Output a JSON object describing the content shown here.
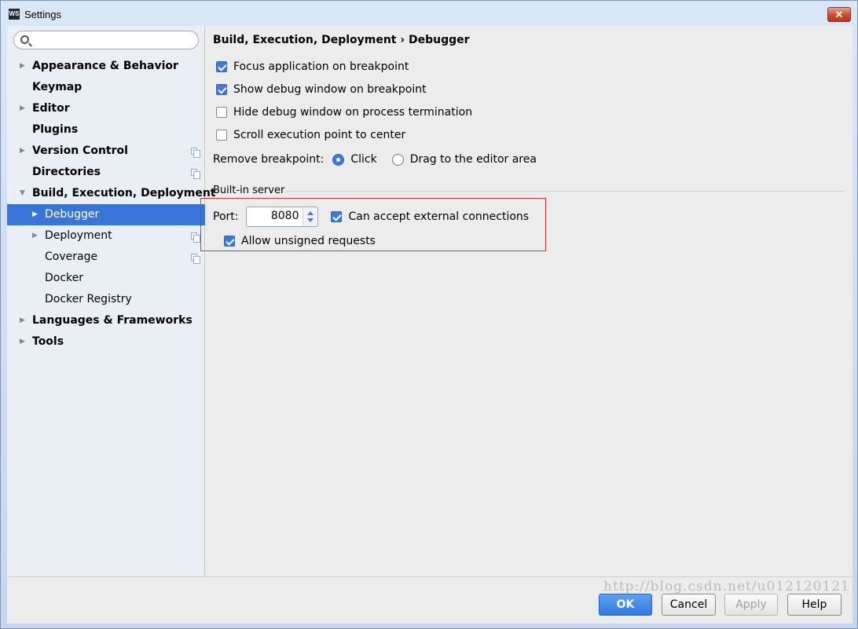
{
  "window": {
    "title": "Settings",
    "app_icon_text": "WS",
    "close_symbol": "✕"
  },
  "search": {
    "placeholder": "",
    "value": ""
  },
  "sidebar": {
    "items": [
      {
        "label": "Appearance & Behavior",
        "expandable": true,
        "bold": true,
        "level": 0,
        "copy_icon": false
      },
      {
        "label": "Keymap",
        "expandable": false,
        "bold": true,
        "level": 0,
        "copy_icon": false
      },
      {
        "label": "Editor",
        "expandable": true,
        "bold": true,
        "level": 0,
        "copy_icon": false
      },
      {
        "label": "Plugins",
        "expandable": false,
        "bold": true,
        "level": 0,
        "copy_icon": false
      },
      {
        "label": "Version Control",
        "expandable": true,
        "bold": true,
        "level": 0,
        "copy_icon": true
      },
      {
        "label": "Directories",
        "expandable": false,
        "bold": true,
        "level": 0,
        "copy_icon": true
      },
      {
        "label": "Build, Execution, Deployment",
        "expandable": true,
        "expanded": true,
        "bold": true,
        "level": 0,
        "copy_icon": false
      },
      {
        "label": "Debugger",
        "expandable": true,
        "bold": false,
        "level": 1,
        "copy_icon": false,
        "selected": true
      },
      {
        "label": "Deployment",
        "expandable": true,
        "bold": false,
        "level": 1,
        "copy_icon": true
      },
      {
        "label": "Coverage",
        "expandable": false,
        "bold": false,
        "level": 1,
        "copy_icon": true
      },
      {
        "label": "Docker",
        "expandable": false,
        "bold": false,
        "level": 1,
        "copy_icon": false
      },
      {
        "label": "Docker Registry",
        "expandable": false,
        "bold": false,
        "level": 1,
        "copy_icon": false
      },
      {
        "label": "Languages & Frameworks",
        "expandable": true,
        "bold": true,
        "level": 0,
        "copy_icon": false
      },
      {
        "label": "Tools",
        "expandable": true,
        "bold": true,
        "level": 0,
        "copy_icon": false
      }
    ]
  },
  "content": {
    "breadcrumb": "Build, Execution, Deployment › Debugger",
    "options": [
      {
        "label": "Focus application on breakpoint",
        "checked": true
      },
      {
        "label": "Show debug window on breakpoint",
        "checked": true
      },
      {
        "label": "Hide debug window on process termination",
        "checked": false
      },
      {
        "label": "Scroll execution point to center",
        "checked": false
      }
    ],
    "remove_breakpoint": {
      "label": "Remove breakpoint:",
      "options": [
        {
          "label": "Click",
          "checked": true
        },
        {
          "label": "Drag to the editor area",
          "checked": false
        }
      ]
    },
    "builtin_server": {
      "title": "Built-in server",
      "port_label": "Port:",
      "port_value": "8080",
      "external_label": "Can accept external connections",
      "external_checked": true,
      "unsigned_label": "Allow unsigned requests",
      "unsigned_checked": true
    }
  },
  "footer": {
    "ok": "OK",
    "cancel": "Cancel",
    "apply": "Apply",
    "help": "Help"
  },
  "watermark": "http://blog.csdn.net/u012120121",
  "colors": {
    "selection": "#3875d7",
    "accent": "#3d7bd6",
    "highlight_box": "#e23030"
  }
}
